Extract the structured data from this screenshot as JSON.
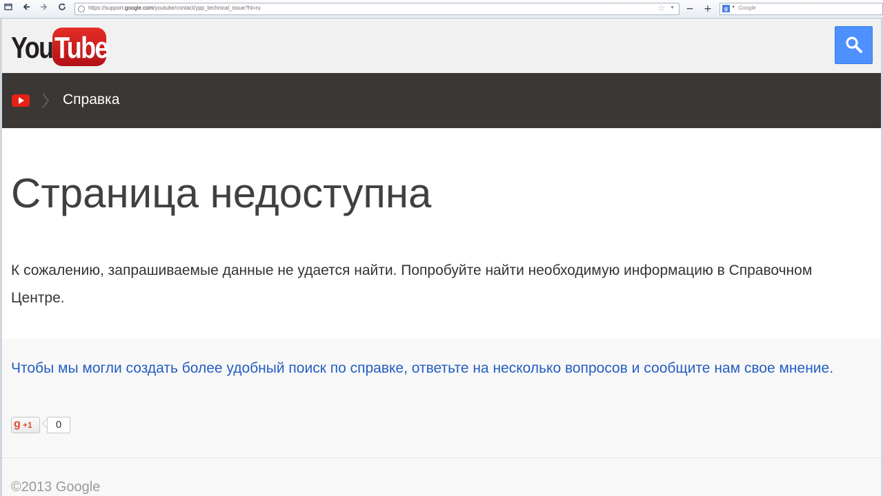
{
  "browser": {
    "url_prefix": "https://support.",
    "url_domain": "google.com",
    "url_path": "/youtube/contact/ypp_technical_issue?hl=ru",
    "search_placeholder": "Google",
    "zoom_out_label": "−",
    "zoom_in_label": "+"
  },
  "header": {
    "logo_you": "You",
    "logo_tube": "Tube"
  },
  "breadcrumb": {
    "label": "Справка"
  },
  "main": {
    "title": "Страница недоступна",
    "message": "К сожалению, запрашиваемые данные не удается найти. Попробуйте найти необходимую информацию в Справочном Центре."
  },
  "feedback": {
    "link_text": "Чтобы мы могли создать более удобный поиск по справке, ответьте на несколько вопросов и сообщите нам свое мнение.",
    "plus_label": "+1",
    "plus_count": "0"
  },
  "footer": {
    "copyright": "©2013 Google"
  },
  "colors": {
    "brand_red": "#e52d27",
    "search_blue": "#4d90fe",
    "breadcrumb_bg": "#3a3734",
    "link_blue": "#245dc1"
  }
}
